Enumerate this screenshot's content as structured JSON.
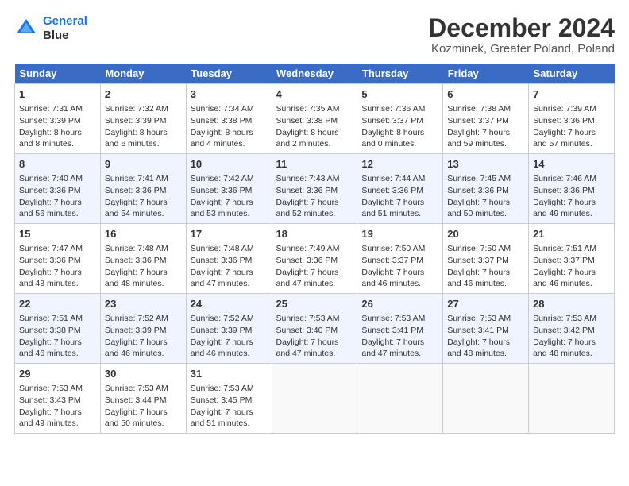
{
  "logo": {
    "line1": "General",
    "line2": "Blue"
  },
  "title": "December 2024",
  "subtitle": "Kozminek, Greater Poland, Poland",
  "days_header": [
    "Sunday",
    "Monday",
    "Tuesday",
    "Wednesday",
    "Thursday",
    "Friday",
    "Saturday"
  ],
  "weeks": [
    [
      {
        "day": "1",
        "rise": "Sunrise: 7:31 AM",
        "set": "Sunset: 3:39 PM",
        "daylight": "Daylight: 8 hours and 8 minutes."
      },
      {
        "day": "2",
        "rise": "Sunrise: 7:32 AM",
        "set": "Sunset: 3:39 PM",
        "daylight": "Daylight: 8 hours and 6 minutes."
      },
      {
        "day": "3",
        "rise": "Sunrise: 7:34 AM",
        "set": "Sunset: 3:38 PM",
        "daylight": "Daylight: 8 hours and 4 minutes."
      },
      {
        "day": "4",
        "rise": "Sunrise: 7:35 AM",
        "set": "Sunset: 3:38 PM",
        "daylight": "Daylight: 8 hours and 2 minutes."
      },
      {
        "day": "5",
        "rise": "Sunrise: 7:36 AM",
        "set": "Sunset: 3:37 PM",
        "daylight": "Daylight: 8 hours and 0 minutes."
      },
      {
        "day": "6",
        "rise": "Sunrise: 7:38 AM",
        "set": "Sunset: 3:37 PM",
        "daylight": "Daylight: 7 hours and 59 minutes."
      },
      {
        "day": "7",
        "rise": "Sunrise: 7:39 AM",
        "set": "Sunset: 3:36 PM",
        "daylight": "Daylight: 7 hours and 57 minutes."
      }
    ],
    [
      {
        "day": "8",
        "rise": "Sunrise: 7:40 AM",
        "set": "Sunset: 3:36 PM",
        "daylight": "Daylight: 7 hours and 56 minutes."
      },
      {
        "day": "9",
        "rise": "Sunrise: 7:41 AM",
        "set": "Sunset: 3:36 PM",
        "daylight": "Daylight: 7 hours and 54 minutes."
      },
      {
        "day": "10",
        "rise": "Sunrise: 7:42 AM",
        "set": "Sunset: 3:36 PM",
        "daylight": "Daylight: 7 hours and 53 minutes."
      },
      {
        "day": "11",
        "rise": "Sunrise: 7:43 AM",
        "set": "Sunset: 3:36 PM",
        "daylight": "Daylight: 7 hours and 52 minutes."
      },
      {
        "day": "12",
        "rise": "Sunrise: 7:44 AM",
        "set": "Sunset: 3:36 PM",
        "daylight": "Daylight: 7 hours and 51 minutes."
      },
      {
        "day": "13",
        "rise": "Sunrise: 7:45 AM",
        "set": "Sunset: 3:36 PM",
        "daylight": "Daylight: 7 hours and 50 minutes."
      },
      {
        "day": "14",
        "rise": "Sunrise: 7:46 AM",
        "set": "Sunset: 3:36 PM",
        "daylight": "Daylight: 7 hours and 49 minutes."
      }
    ],
    [
      {
        "day": "15",
        "rise": "Sunrise: 7:47 AM",
        "set": "Sunset: 3:36 PM",
        "daylight": "Daylight: 7 hours and 48 minutes."
      },
      {
        "day": "16",
        "rise": "Sunrise: 7:48 AM",
        "set": "Sunset: 3:36 PM",
        "daylight": "Daylight: 7 hours and 48 minutes."
      },
      {
        "day": "17",
        "rise": "Sunrise: 7:48 AM",
        "set": "Sunset: 3:36 PM",
        "daylight": "Daylight: 7 hours and 47 minutes."
      },
      {
        "day": "18",
        "rise": "Sunrise: 7:49 AM",
        "set": "Sunset: 3:36 PM",
        "daylight": "Daylight: 7 hours and 47 minutes."
      },
      {
        "day": "19",
        "rise": "Sunrise: 7:50 AM",
        "set": "Sunset: 3:37 PM",
        "daylight": "Daylight: 7 hours and 46 minutes."
      },
      {
        "day": "20",
        "rise": "Sunrise: 7:50 AM",
        "set": "Sunset: 3:37 PM",
        "daylight": "Daylight: 7 hours and 46 minutes."
      },
      {
        "day": "21",
        "rise": "Sunrise: 7:51 AM",
        "set": "Sunset: 3:37 PM",
        "daylight": "Daylight: 7 hours and 46 minutes."
      }
    ],
    [
      {
        "day": "22",
        "rise": "Sunrise: 7:51 AM",
        "set": "Sunset: 3:38 PM",
        "daylight": "Daylight: 7 hours and 46 minutes."
      },
      {
        "day": "23",
        "rise": "Sunrise: 7:52 AM",
        "set": "Sunset: 3:39 PM",
        "daylight": "Daylight: 7 hours and 46 minutes."
      },
      {
        "day": "24",
        "rise": "Sunrise: 7:52 AM",
        "set": "Sunset: 3:39 PM",
        "daylight": "Daylight: 7 hours and 46 minutes."
      },
      {
        "day": "25",
        "rise": "Sunrise: 7:53 AM",
        "set": "Sunset: 3:40 PM",
        "daylight": "Daylight: 7 hours and 47 minutes."
      },
      {
        "day": "26",
        "rise": "Sunrise: 7:53 AM",
        "set": "Sunset: 3:41 PM",
        "daylight": "Daylight: 7 hours and 47 minutes."
      },
      {
        "day": "27",
        "rise": "Sunrise: 7:53 AM",
        "set": "Sunset: 3:41 PM",
        "daylight": "Daylight: 7 hours and 48 minutes."
      },
      {
        "day": "28",
        "rise": "Sunrise: 7:53 AM",
        "set": "Sunset: 3:42 PM",
        "daylight": "Daylight: 7 hours and 48 minutes."
      }
    ],
    [
      {
        "day": "29",
        "rise": "Sunrise: 7:53 AM",
        "set": "Sunset: 3:43 PM",
        "daylight": "Daylight: 7 hours and 49 minutes."
      },
      {
        "day": "30",
        "rise": "Sunrise: 7:53 AM",
        "set": "Sunset: 3:44 PM",
        "daylight": "Daylight: 7 hours and 50 minutes."
      },
      {
        "day": "31",
        "rise": "Sunrise: 7:53 AM",
        "set": "Sunset: 3:45 PM",
        "daylight": "Daylight: 7 hours and 51 minutes."
      },
      null,
      null,
      null,
      null
    ]
  ]
}
